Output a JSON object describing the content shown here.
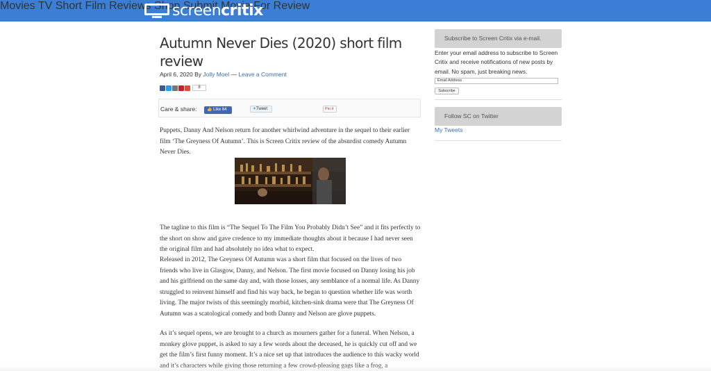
{
  "site": {
    "logo_light": "screen",
    "logo_bold": "critix",
    "nav": [
      "Movies",
      "TV",
      "Short Film Reviews",
      "Shop",
      "Submit Movie For Review"
    ],
    "brand_color": "#3a7ed6"
  },
  "post": {
    "title": "Autumn Never Dies (2020) short film review",
    "date_by": "April 6, 2020 By ",
    "author": "Jolly Moel",
    "separator": " — ",
    "comment_link": "Leave a Comment",
    "share_count": "8",
    "care_label": "Care & share:",
    "fb_like": "Like 64",
    "tweet": "Tweet",
    "pin": "Pin it",
    "paragraphs": [
      "Puppets, Danny And Nelson return for another whirlwind adventure in the sequel to their earlier film ‘The Greyness Of Autumn’. This is Screen Critix review of the absurdist comedy Autumn Never Dies.",
      "The tagline to this film is “The Sequel To The Film You Probably Didn’t See” and it fits perfectly to the short on show and gave credence to my immediate thoughts about it because I had never seen the original film and had absolutely no idea what to expect.",
      "Released in 2012, The Greyness Of Autumn was a short film that focused on the lives of two friends who live in Glasgow, Danny, and Nelson. The first movie focused on Danny losing his job and his girlfriend on the same day and, with those losses, any semblance of a normal life. As Danny struggled to reinvent himself and find his way back, he began to question whether life was worth living. The major twists of this seemingly morbid, kitchen-sink drama were that The Greyness Of Autumn was a scatological comedy and both Danny and Nelson are glove puppets.",
      "As it’s sequel opens, we are brought to a church as mourners gather for a funeral. When Nelson, a monkey glove puppet, is asked to say a few words about the deceased, he is quickly cut off and we get the film’s first funny moment. It’s a nice set up that introduces the audience to this wacky world and it’s characters while giving those returning a few crowd-pleasing gags like a frog, a"
    ]
  },
  "sidebar": {
    "subscribe_title": "Subscribe to Screen Critix via e-mail.",
    "subscribe_text": "Enter your email address to subscribe to Screen Critix and receive notifications of new posts by email. No spam, just breaking news.",
    "email_placeholder": "Email Address",
    "subscribe_button": "Subscribe",
    "twitter_title": "Follow SC on Twitter",
    "my_tweets": "My Tweets"
  }
}
